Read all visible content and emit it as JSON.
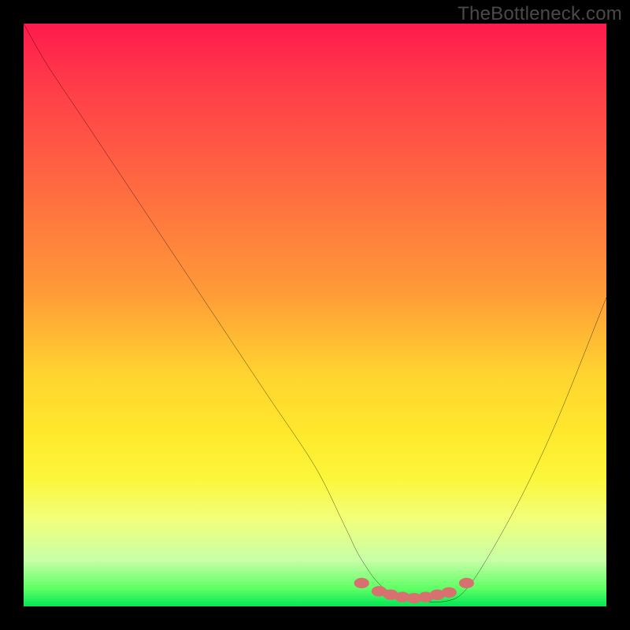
{
  "watermark": "TheBottleneck.com",
  "chart_data": {
    "type": "line",
    "title": "",
    "xlabel": "",
    "ylabel": "",
    "x_range": [
      0,
      100
    ],
    "y_range": [
      0,
      100
    ],
    "grid": false,
    "legend": false,
    "background": "vertical-gradient red→yellow→green",
    "series": [
      {
        "name": "bottleneck-curve",
        "color": "#000000",
        "x": [
          0,
          4,
          10,
          18,
          26,
          34,
          42,
          50,
          55,
          58,
          62,
          68,
          73,
          76,
          80,
          86,
          92,
          100
        ],
        "y": [
          100,
          93,
          84,
          72,
          60,
          48,
          36,
          24,
          14,
          8,
          3,
          1,
          1,
          3,
          9,
          20,
          33,
          53
        ]
      }
    ],
    "annotations": [
      {
        "name": "optimal-region-dots",
        "type": "markers",
        "color": "#d87070",
        "x": [
          58,
          61,
          63,
          65,
          67,
          69,
          71,
          73,
          76
        ],
        "y": [
          4,
          2.6,
          2.0,
          1.6,
          1.4,
          1.6,
          2.0,
          2.4,
          4
        ]
      }
    ]
  }
}
